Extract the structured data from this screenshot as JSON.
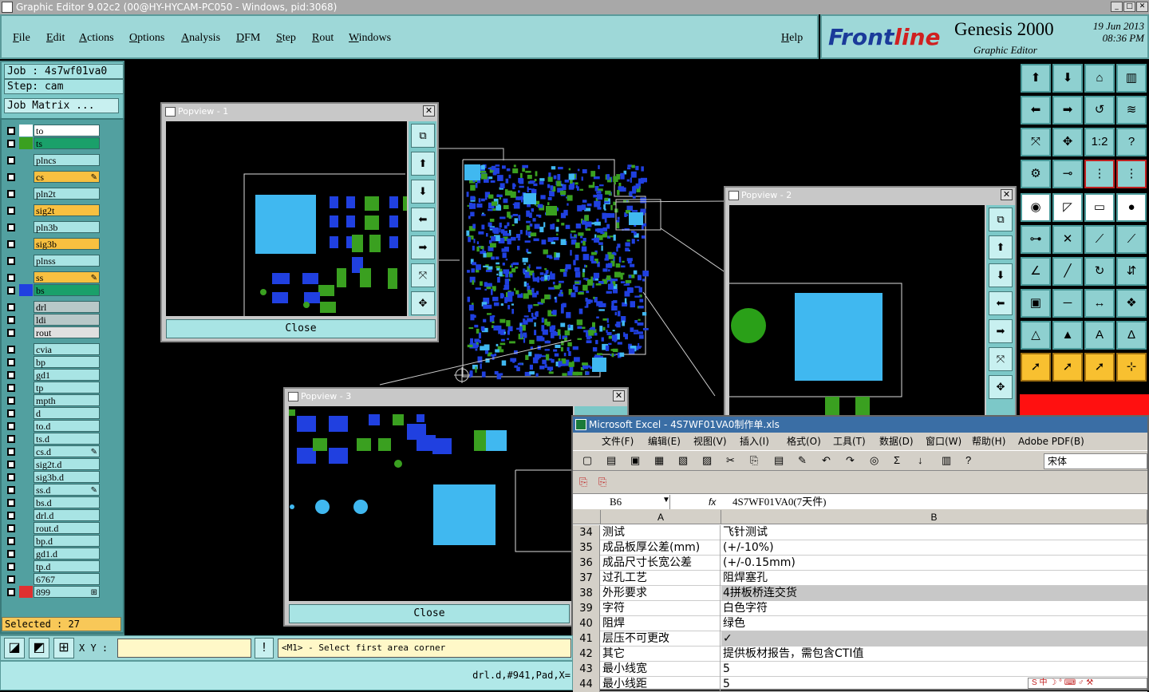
{
  "window": {
    "title": "Graphic Editor 9.02c2 (00@HY-HYCAM-PC050 - Windows, pid:3068)"
  },
  "menu": [
    "File",
    "Edit",
    "Actions",
    "Options",
    "Analysis",
    "DFM",
    "Step",
    "Rout",
    "Windows"
  ],
  "help": "Help",
  "brand": {
    "logo_a": "Front",
    "logo_b": "line",
    "product": "Genesis 2000",
    "subtitle": "Graphic Editor",
    "date": "19 Jun 2013",
    "time": "08:36 PM"
  },
  "job": {
    "job": "Job : 4s7wf01va0",
    "step": "Step: cam",
    "matrix": "Job Matrix ..."
  },
  "layers": [
    {
      "name": "to",
      "color": "#ffffff",
      "swatch": "#ffffff",
      "mark": ""
    },
    {
      "name": "ts",
      "color": "#1aa06a",
      "swatch": "#3aa020",
      "mark": ""
    },
    {
      "name": "plncs",
      "color": "#a8e4e4",
      "swatch": "",
      "mark": ""
    },
    {
      "name": "cs",
      "color": "#f8c040",
      "swatch": "",
      "mark": "✎"
    },
    {
      "name": "pln2t",
      "color": "#a8e4e4",
      "swatch": "",
      "mark": ""
    },
    {
      "name": "sig2t",
      "color": "#f8c040",
      "swatch": "",
      "mark": ""
    },
    {
      "name": "pln3b",
      "color": "#a8e4e4",
      "swatch": "",
      "mark": ""
    },
    {
      "name": "sig3b",
      "color": "#f8c040",
      "swatch": "",
      "mark": ""
    },
    {
      "name": "plnss",
      "color": "#a8e4e4",
      "swatch": "",
      "mark": ""
    },
    {
      "name": "ss",
      "color": "#f8c040",
      "swatch": "",
      "mark": "✎"
    },
    {
      "name": "bs",
      "color": "#1aa06a",
      "swatch": "#2040e0",
      "mark": ""
    },
    {
      "name": "drl",
      "color": "#b8c8c8",
      "swatch": "",
      "mark": ""
    },
    {
      "name": "ldi",
      "color": "#b8c8c8",
      "swatch": "",
      "mark": ""
    },
    {
      "name": "rout",
      "color": "#e0e0e0",
      "swatch": "",
      "mark": ""
    },
    {
      "name": "cvia",
      "color": "#a8e4e4",
      "swatch": "",
      "mark": ""
    },
    {
      "name": "bp",
      "color": "#a8e4e4",
      "swatch": "",
      "mark": ""
    },
    {
      "name": "gd1",
      "color": "#a8e4e4",
      "swatch": "",
      "mark": ""
    },
    {
      "name": "tp",
      "color": "#a8e4e4",
      "swatch": "",
      "mark": ""
    },
    {
      "name": "mpth",
      "color": "#a8e4e4",
      "swatch": "",
      "mark": ""
    },
    {
      "name": "d",
      "color": "#a8e4e4",
      "swatch": "",
      "mark": ""
    },
    {
      "name": "to.d",
      "color": "#a8e4e4",
      "swatch": "",
      "mark": ""
    },
    {
      "name": "ts.d",
      "color": "#a8e4e4",
      "swatch": "",
      "mark": ""
    },
    {
      "name": "cs.d",
      "color": "#a8e4e4",
      "swatch": "",
      "mark": "✎"
    },
    {
      "name": "sig2t.d",
      "color": "#a8e4e4",
      "swatch": "",
      "mark": ""
    },
    {
      "name": "sig3b.d",
      "color": "#a8e4e4",
      "swatch": "",
      "mark": ""
    },
    {
      "name": "ss.d",
      "color": "#a8e4e4",
      "swatch": "",
      "mark": "✎"
    },
    {
      "name": "bs.d",
      "color": "#a8e4e4",
      "swatch": "",
      "mark": ""
    },
    {
      "name": "drl.d",
      "color": "#a8e4e4",
      "swatch": "",
      "mark": ""
    },
    {
      "name": "rout.d",
      "color": "#a8e4e4",
      "swatch": "",
      "mark": ""
    },
    {
      "name": "bp.d",
      "color": "#a8e4e4",
      "swatch": "",
      "mark": ""
    },
    {
      "name": "gd1.d",
      "color": "#a8e4e4",
      "swatch": "",
      "mark": ""
    },
    {
      "name": "tp.d",
      "color": "#a8e4e4",
      "swatch": "",
      "mark": ""
    },
    {
      "name": "6767",
      "color": "#a8e4e4",
      "swatch": "",
      "mark": ""
    },
    {
      "name": "899",
      "color": "#a8e4e4",
      "swatch": "#e03030",
      "mark": "⊞"
    }
  ],
  "selected": "Selected : 27",
  "status": {
    "xy_label": "X Y :",
    "message": "<M1> - Select first area corner",
    "cmd": "drl.d,#941,Pad,X="
  },
  "popups": {
    "p1": "Popview - 1",
    "p2": "Popview - 2",
    "p3": "Popview - 3",
    "close": "Close"
  },
  "excel": {
    "title": "Microsoft Excel - 4S7WF01VA0制作单.xls",
    "menu": [
      "文件(F)",
      "编辑(E)",
      "视图(V)",
      "插入(I)",
      "格式(O)",
      "工具(T)",
      "数据(D)",
      "窗口(W)",
      "帮助(H)",
      "Adobe PDF(B)"
    ],
    "font": "宋体",
    "cell_ref": "B6",
    "fx": "fx",
    "formula": "4S7WF01VA0(7天件)",
    "col_a": "A",
    "col_b": "B",
    "rows": [
      {
        "n": "34",
        "a": "测试",
        "b": "飞针测试"
      },
      {
        "n": "35",
        "a": "成品板厚公差(mm)",
        "b": "(+/-10%)"
      },
      {
        "n": "36",
        "a": "成品尺寸长宽公差",
        "b": "(+/-0.15mm)"
      },
      {
        "n": "37",
        "a": "过孔工艺",
        "b": "阻焊塞孔"
      },
      {
        "n": "38",
        "a": "外形要求",
        "b": "4拼板桥连交货"
      },
      {
        "n": "39",
        "a": "字符",
        "b": "白色字符"
      },
      {
        "n": "40",
        "a": "阻焊",
        "b": "绿色"
      },
      {
        "n": "41",
        "a": "层压不可更改",
        "b": "✓"
      },
      {
        "n": "42",
        "a": "其它",
        "b": "提供板材报告，需包含CTI值"
      },
      {
        "n": "43",
        "a": "最小线宽",
        "b": "5"
      },
      {
        "n": "44",
        "a": "最小线距",
        "b": "5"
      }
    ]
  },
  "colors": {
    "panel": "#9ed8d8",
    "blue": "#2040e0",
    "cyan": "#40b8f0",
    "green": "#3aa020"
  }
}
